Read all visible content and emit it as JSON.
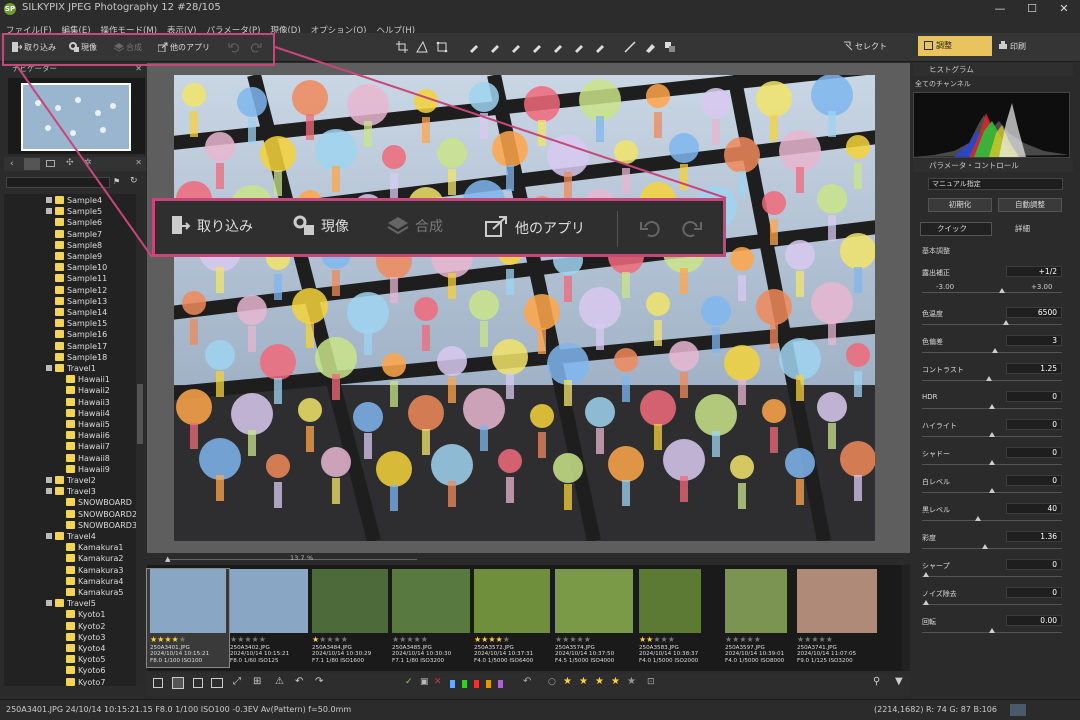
{
  "title_bar": {
    "logo": "SP",
    "title": "SILKYPIX JPEG Photography 12   #28/105",
    "minimize": "—",
    "maximize": "☐",
    "close": "✕"
  },
  "menu": [
    "ファイル(F)",
    "編集(E)",
    "操作モード(M)",
    "表示(V)",
    "パラメータ(P)",
    "現像(D)",
    "オプション(O)",
    "ヘルプ(H)"
  ],
  "toolbar": {
    "import_label": "取り込み",
    "develop_label": "現像",
    "composite_label": "合成",
    "other_apps_label": "他のアプリ",
    "select_label": "セレクト",
    "adjust_label": "調整",
    "print_label": "印刷"
  },
  "callout": {
    "import_label": "取り込み",
    "develop_label": "現像",
    "composite_label": "合成",
    "other_apps_label": "他のアプリ"
  },
  "navigator": {
    "title": "ナビゲーター"
  },
  "tree": {
    "items": [
      {
        "label": "Sample4",
        "level": 1,
        "expand": true
      },
      {
        "label": "Sample5",
        "level": 1,
        "expand": true
      },
      {
        "label": "Sample6",
        "level": 1,
        "expand": false
      },
      {
        "label": "Sample7",
        "level": 1,
        "expand": false
      },
      {
        "label": "Sample8",
        "level": 1,
        "expand": false
      },
      {
        "label": "Sample9",
        "level": 1,
        "expand": false
      },
      {
        "label": "Sample10",
        "level": 1,
        "expand": false
      },
      {
        "label": "Sample11",
        "level": 1,
        "expand": false
      },
      {
        "label": "Sample12",
        "level": 1,
        "expand": false
      },
      {
        "label": "Sample13",
        "level": 1,
        "expand": false
      },
      {
        "label": "Sample14",
        "level": 1,
        "expand": false
      },
      {
        "label": "Sample15",
        "level": 1,
        "expand": false
      },
      {
        "label": "Sample16",
        "level": 1,
        "expand": false
      },
      {
        "label": "Sample17",
        "level": 1,
        "expand": false
      },
      {
        "label": "Sample18",
        "level": 1,
        "expand": false
      },
      {
        "label": "Travel1",
        "level": 1,
        "expand": true
      },
      {
        "label": "Hawaii1",
        "level": 2,
        "expand": false
      },
      {
        "label": "Hawaii2",
        "level": 2,
        "expand": false
      },
      {
        "label": "Hawaii3",
        "level": 2,
        "expand": false
      },
      {
        "label": "Hawaii4",
        "level": 2,
        "expand": false
      },
      {
        "label": "Hawaii5",
        "level": 2,
        "expand": false
      },
      {
        "label": "Hawaii6",
        "level": 2,
        "expand": false
      },
      {
        "label": "Hawaii7",
        "level": 2,
        "expand": false
      },
      {
        "label": "Hawaii8",
        "level": 2,
        "expand": false
      },
      {
        "label": "Hawaii9",
        "level": 2,
        "expand": false
      },
      {
        "label": "Travel2",
        "level": 1,
        "expand": true
      },
      {
        "label": "Travel3",
        "level": 1,
        "expand": true
      },
      {
        "label": "SNOWBOARD",
        "level": 2,
        "expand": false
      },
      {
        "label": "SNOWBOARD2",
        "level": 2,
        "expand": false
      },
      {
        "label": "SNOWBOARD3",
        "level": 2,
        "expand": false
      },
      {
        "label": "Travel4",
        "level": 1,
        "expand": true
      },
      {
        "label": "Kamakura1",
        "level": 2,
        "expand": false
      },
      {
        "label": "Kamakura2",
        "level": 2,
        "expand": false
      },
      {
        "label": "Kamakura3",
        "level": 2,
        "expand": false
      },
      {
        "label": "Kamakura4",
        "level": 2,
        "expand": false
      },
      {
        "label": "Kamakura5",
        "level": 2,
        "expand": false
      },
      {
        "label": "Travel5",
        "level": 1,
        "expand": true
      },
      {
        "label": "Kyoto1",
        "level": 2,
        "expand": false
      },
      {
        "label": "Kyoto2",
        "level": 2,
        "expand": false
      },
      {
        "label": "Kyoto3",
        "level": 2,
        "expand": false
      },
      {
        "label": "Kyoto4",
        "level": 2,
        "expand": false
      },
      {
        "label": "Kyoto5",
        "level": 2,
        "expand": false
      },
      {
        "label": "Kyoto6",
        "level": 2,
        "expand": false
      },
      {
        "label": "Kyoto7",
        "level": 2,
        "expand": false
      }
    ]
  },
  "zoom": {
    "value": "13.7",
    "unit": "%"
  },
  "filmstrip": [
    {
      "name": "250A3401.JPG",
      "date": "2024/10/14 10:15:21",
      "exif": "F8.0 1/100 ISO100",
      "stars": 4,
      "selected": true
    },
    {
      "name": "250A3402.JPG",
      "date": "2024/10/14 10:15:21",
      "exif": "F8.0 1/60 ISO125",
      "stars": 0,
      "selected": false
    },
    {
      "name": "250A3484.JPG",
      "date": "2024/10/14 10:30:29",
      "exif": "F7.1 1/80 ISO1600",
      "stars": 1,
      "selected": false
    },
    {
      "name": "250A3485.JPG",
      "date": "2024/10/14 10:30:30",
      "exif": "F7.1 1/80 ISO3200",
      "stars": 0,
      "selected": false
    },
    {
      "name": "250A3572.JPG",
      "date": "2024/10/14 10:37:31",
      "exif": "F4.0 1/5000 ISO6400",
      "stars": 4,
      "selected": false
    },
    {
      "name": "250A3574.JPG",
      "date": "2024/10/14 10:37:50",
      "exif": "F4.5 1/5000 ISO4000",
      "stars": 0,
      "selected": false
    },
    {
      "name": "250A3583.JPG",
      "date": "2024/10/14 10:38:37",
      "exif": "F4.0 1/5000 ISO2000",
      "stars": 2,
      "selected": false
    },
    {
      "name": "250A3597.JPG",
      "date": "2024/10/14 10:39:01",
      "exif": "F4.0 1/5000 ISO8000",
      "stars": 0,
      "selected": false
    },
    {
      "name": "250A3741.JPG",
      "date": "2024/10/14 11:07:05",
      "exif": "F9.0 1/125 ISO3200",
      "stars": 0,
      "selected": false
    }
  ],
  "status": {
    "left": "250A3401.JPG 24/10/14 10:15:21.15 F8.0 1/100 ISO100 -0.3EV Av(Pattern) f=50.0mm",
    "right": "(2214,1682) R: 74 G: 87 B:106"
  },
  "right_panel": {
    "histogram_title": "ヒストグラム",
    "channel": "全てのチャンネル",
    "param_title": "パラメータ・コントロール",
    "preset": "マニュアル指定",
    "init_button": "初期化",
    "auto_button": "自動調整",
    "quick_tab": "クイック",
    "detail_tab": "詳細",
    "basic_section": "基本調整",
    "exposure_min": "-3.00",
    "exposure_max": "+3.00",
    "params": [
      {
        "label": "露出補正",
        "value": "+1/2",
        "level": 0.57
      },
      {
        "label": "色温度",
        "value": "6500",
        "level": 0.6
      },
      {
        "label": "色偏差",
        "value": "3",
        "level": 0.52
      },
      {
        "label": "コントラスト",
        "value": "1.25",
        "level": 0.48
      },
      {
        "label": "HDR",
        "value": "0",
        "level": 0.5
      },
      {
        "label": "ハイライト",
        "value": "0",
        "level": 0.5
      },
      {
        "label": "シャドー",
        "value": "0",
        "level": 0.5
      },
      {
        "label": "白レベル",
        "value": "0",
        "level": 0.5
      },
      {
        "label": "黒レベル",
        "value": "40",
        "level": 0.4
      },
      {
        "label": "彩度",
        "value": "1.36",
        "level": 0.45
      },
      {
        "label": "シャープ",
        "value": "0",
        "level": 0.03
      },
      {
        "label": "ノイズ除去",
        "value": "0",
        "level": 0.03
      },
      {
        "label": "回転",
        "value": "0.00",
        "level": 0.5
      }
    ]
  },
  "colors": {
    "accent_yellow": "#e9c45e",
    "callout_magenta": "#c8467a",
    "star": "#ffd233",
    "folder": "#f3d458"
  }
}
